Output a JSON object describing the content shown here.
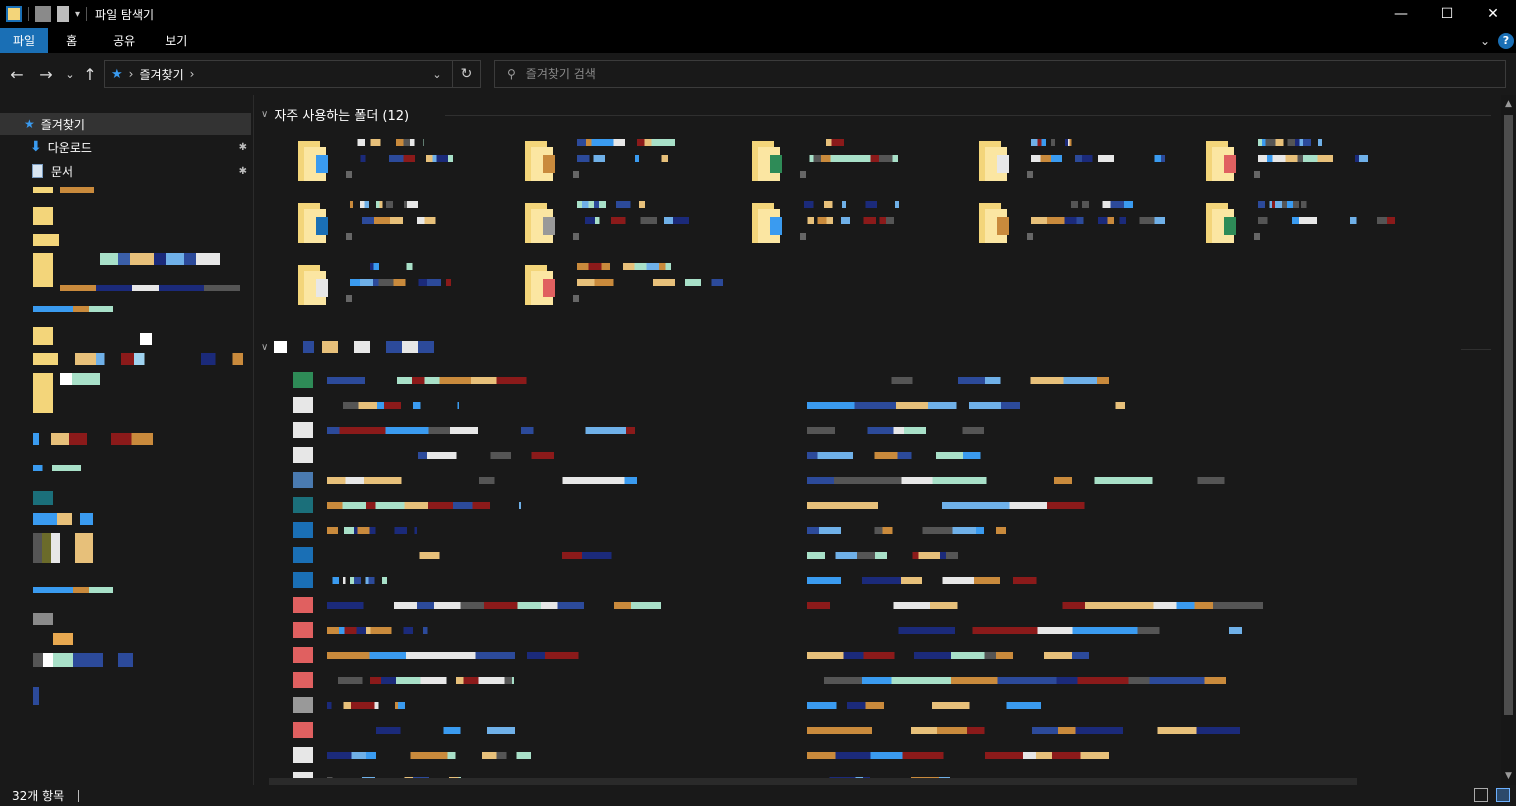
{
  "window": {
    "title": "파일 탐색기",
    "controls": {
      "minimize": "—",
      "maximize": "☐",
      "close": "✕"
    }
  },
  "ribbon": {
    "tabs": [
      "파일",
      "홈",
      "공유",
      "보기"
    ],
    "active_tab": "파일",
    "expand_icon": "chevron-down-icon",
    "help_label": "?"
  },
  "nav": {
    "back": "←",
    "forward": "→",
    "recent": "⌄",
    "up": "↑"
  },
  "address": {
    "crumbs": [
      "즐겨찾기"
    ],
    "separator": "›",
    "dropdown": "⌄",
    "refresh": "↻"
  },
  "search": {
    "placeholder": "즐겨찾기 검색",
    "value": ""
  },
  "navpane": {
    "items": [
      {
        "label": "즐겨찾기",
        "icon": "star-icon",
        "selected": true
      },
      {
        "label": "다운로드",
        "icon": "download-icon",
        "pinned": true
      },
      {
        "label": "문서",
        "icon": "document-icon",
        "pinned": true
      }
    ],
    "pin_glyph": "📌"
  },
  "content": {
    "frequent_header": "자주 사용하는 폴더 (12)",
    "frequent_count": 12,
    "recent_header": ""
  },
  "status": {
    "item_count": "32개 항목"
  },
  "colors": {
    "accent": "#1a6fb5",
    "background": "#191919",
    "chrome": "#000000",
    "folder": "#f3d57a"
  }
}
